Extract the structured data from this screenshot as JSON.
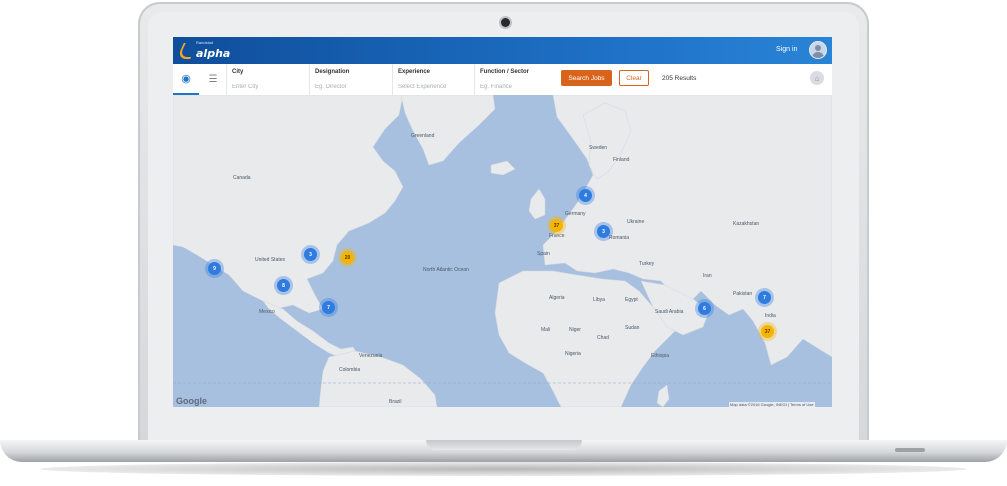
{
  "header": {
    "logo_text": "alpha",
    "logo_small_text": "Randstad",
    "signin_label": "Sign in"
  },
  "search": {
    "fields": [
      {
        "label": "City",
        "placeholder": "Enter City"
      },
      {
        "label": "Designation",
        "placeholder": "Eg. Director"
      },
      {
        "label": "Experience",
        "placeholder": "Select Experience"
      },
      {
        "label": "Function / Sector",
        "placeholder": "Eg. Finance"
      }
    ],
    "search_button": "Search Jobs",
    "clear_button": "Clear",
    "results": "205 Results"
  },
  "map": {
    "clusters": [
      {
        "count": "9",
        "color": "blue"
      },
      {
        "count": "3",
        "color": "blue"
      },
      {
        "count": "20",
        "color": "orange"
      },
      {
        "count": "8",
        "color": "blue"
      },
      {
        "count": "7",
        "color": "blue"
      },
      {
        "count": "4",
        "color": "blue"
      },
      {
        "count": "37",
        "color": "orange"
      },
      {
        "count": "3",
        "color": "blue"
      },
      {
        "count": "6",
        "color": "blue"
      },
      {
        "count": "7",
        "color": "blue"
      },
      {
        "count": "37",
        "color": "orange"
      }
    ],
    "labels": {
      "greenland": "Greenland",
      "united_states": "United States",
      "mexico": "Mexico",
      "venezuela": "Venezuela",
      "colombia": "Colombia",
      "brazil": "Brazil",
      "sweden": "Sweden",
      "finland": "Finland",
      "germany": "Germany",
      "france": "France",
      "spain": "Spain",
      "ukraine": "Ukraine",
      "romania": "Romania",
      "turkey": "Turkey",
      "kazakhstan": "Kazakhstan",
      "algeria": "Algeria",
      "libya": "Libya",
      "egypt": "Egypt",
      "mali": "Mali",
      "niger": "Niger",
      "chad": "Chad",
      "sudan": "Sudan",
      "nigeria": "Nigeria",
      "ethiopia": "Ethiopia",
      "saudi_arabia": "Saudi Arabia",
      "iran": "Iran",
      "pakistan": "Pakistan",
      "india": "India",
      "atlantic": "North Atlantic Ocean",
      "canada": "Canada"
    },
    "zoom_in": "+",
    "zoom_out": "−",
    "google": "Google",
    "credit": "Map data ©2016 Google, INEGI | Terms of Use"
  },
  "colors": {
    "topbar": "#1f73c9",
    "accent": "#d8641c",
    "water": "#a7c0e0",
    "land": "#e8eaec"
  }
}
